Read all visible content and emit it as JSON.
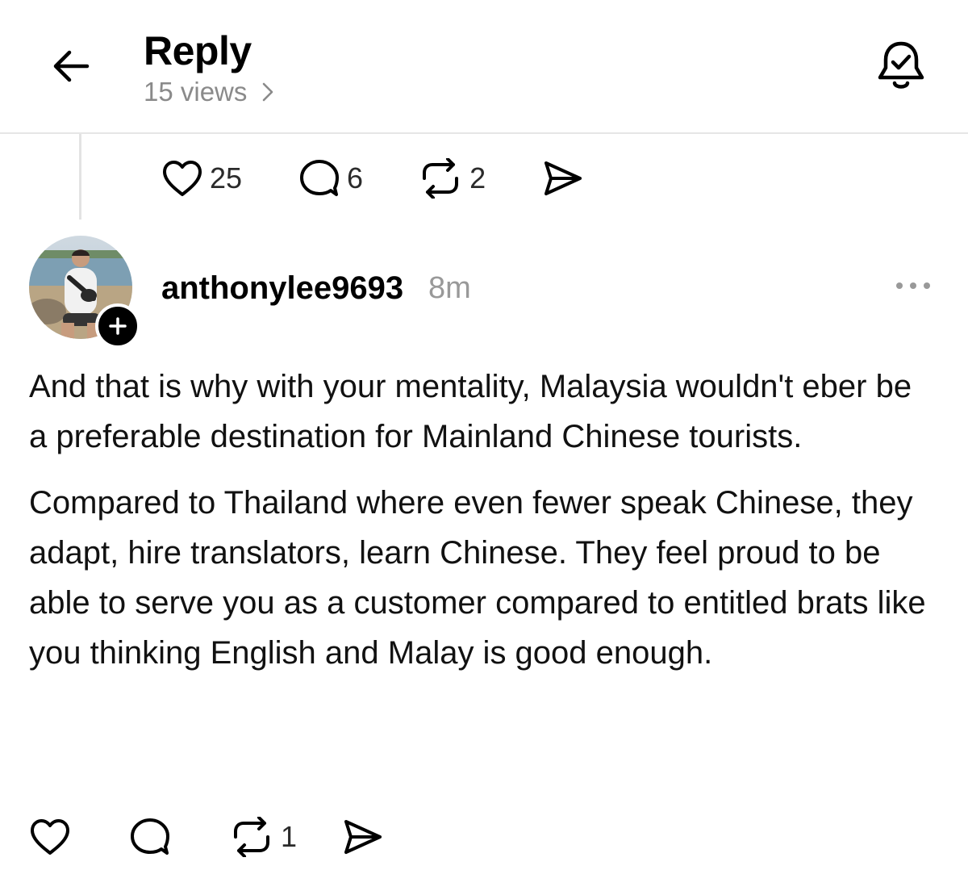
{
  "header": {
    "title": "Reply",
    "views": "15 views",
    "views_chevron": "›"
  },
  "parent_post": {
    "likes": "25",
    "replies": "6",
    "reposts": "2"
  },
  "post": {
    "username": "anthonylee9693",
    "time": "8m",
    "paragraphs": [
      "And that is why with your mentality, Malaysia wouldn't eber be a preferable destination for Mainland Chinese tourists.",
      "Compared to Thailand where even fewer speak Chinese, they adapt, hire translators, learn Chinese. They feel proud to be able to serve you as a customer compared to entitled brats like you thinking English and Malay is good enough."
    ],
    "reposts": "1"
  },
  "icons": {
    "back": "arrow-left-icon",
    "bell": "bell-check-icon",
    "like": "heart-icon",
    "reply": "comment-bubble-icon",
    "repost": "repost-icon",
    "share": "send-icon",
    "more": "more-dots-icon",
    "follow": "plus-icon"
  }
}
